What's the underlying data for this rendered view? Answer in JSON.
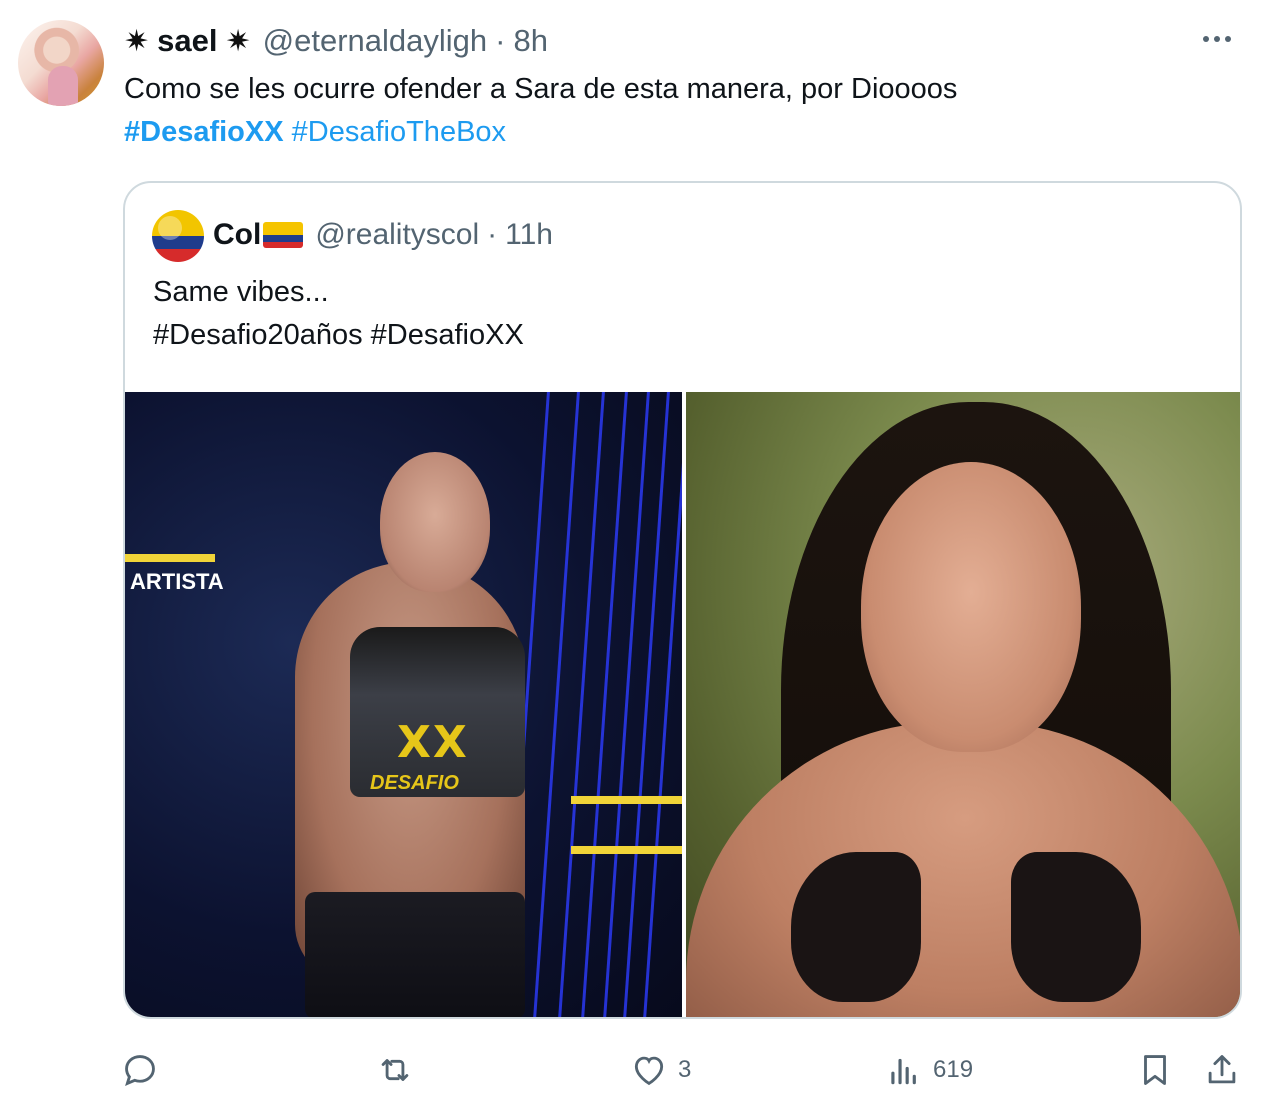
{
  "tweet": {
    "author": {
      "name": "sael",
      "decoration": "✷",
      "handle": "@eternaldayligh",
      "time": "8h"
    },
    "text": "Como se les ocurre ofender a Sara de esta manera, por Dioooos",
    "hashtags": [
      "#DesafioXX",
      "#DesafioTheBox"
    ]
  },
  "quote": {
    "author": {
      "name": "Col",
      "handle": "@realityscol",
      "time": "11h"
    },
    "text_line1": "Same vibes...",
    "text_line2": "#Desafio20años #DesafioXX",
    "images": [
      {
        "overlay_label": "ARTISTA",
        "shirt_text": "XX",
        "shirt_subtext": "DESAFIO"
      },
      {}
    ]
  },
  "actions": {
    "reply": {
      "icon": "reply-icon"
    },
    "retweet": {
      "icon": "retweet-icon"
    },
    "like": {
      "icon": "heart-icon",
      "count": "3"
    },
    "views": {
      "icon": "views-icon",
      "count": "619"
    },
    "bookmark": {
      "icon": "bookmark-icon"
    },
    "share": {
      "icon": "share-icon"
    }
  },
  "colors": {
    "link": "#1d9bf0",
    "secondary_text": "#536471",
    "border": "#cfd9de",
    "accent_yellow": "#f1d438"
  }
}
